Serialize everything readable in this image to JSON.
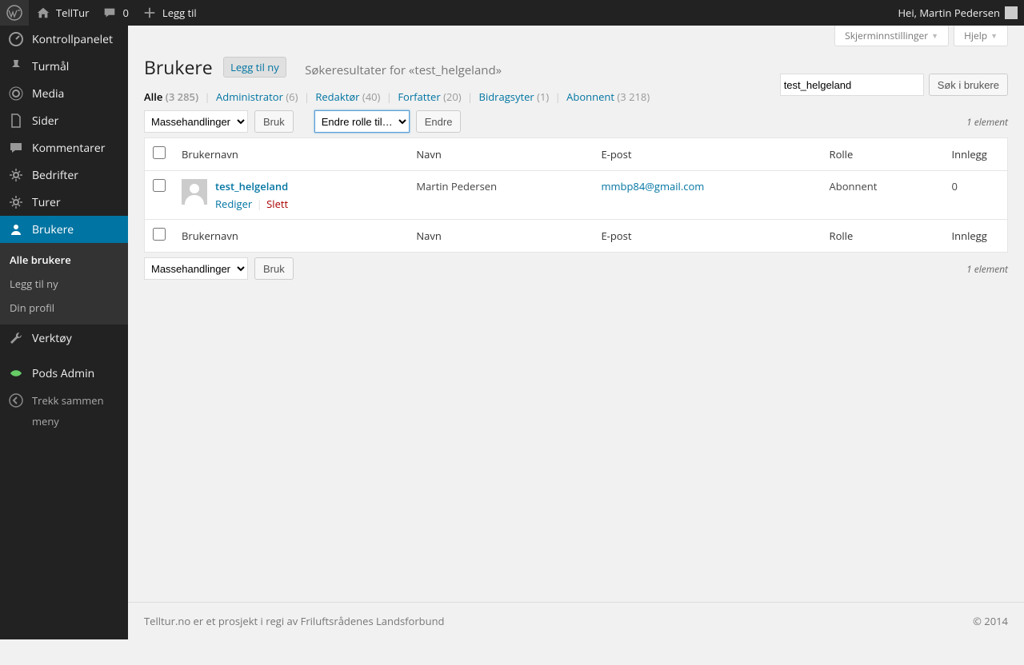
{
  "adminbar": {
    "site_name": "TellTur",
    "comments_count": "0",
    "add_new": "Legg til",
    "greeting": "Hei, Martin Pedersen"
  },
  "sidebar": {
    "items": [
      {
        "label": "Kontrollpanelet"
      },
      {
        "label": "Turmål"
      },
      {
        "label": "Media"
      },
      {
        "label": "Sider"
      },
      {
        "label": "Kommentarer"
      },
      {
        "label": "Bedrifter"
      },
      {
        "label": "Turer"
      },
      {
        "label": "Brukere"
      },
      {
        "label": "Verktøy"
      },
      {
        "label": "Pods Admin"
      }
    ],
    "submenu": [
      {
        "label": "Alle brukere"
      },
      {
        "label": "Legg til ny"
      },
      {
        "label": "Din profil"
      }
    ],
    "collapse1": "Trekk sammen",
    "collapse2": "meny"
  },
  "screen_meta": {
    "screen_options": "Skjerminnstillinger",
    "help": "Hjelp"
  },
  "header": {
    "title": "Brukere",
    "add_new": "Legg til ny",
    "search_results": "Søkeresultater for «test_helgeland»"
  },
  "filters": {
    "all_label": "Alle",
    "all_count": "(3 285)",
    "admin_label": "Administrator",
    "admin_count": "(6)",
    "editor_label": "Redaktør",
    "editor_count": "(40)",
    "author_label": "Forfatter",
    "author_count": "(20)",
    "contrib_label": "Bidragsyter",
    "contrib_count": "(1)",
    "subscriber_label": "Abonnent",
    "subscriber_count": "(3 218)"
  },
  "search": {
    "value": "test_helgeland",
    "button": "Søk i brukere"
  },
  "bulk": {
    "bulk_actions": "Massehandlinger",
    "apply": "Bruk",
    "change_role": "Endre rolle til…",
    "change": "Endre",
    "count_text": "1 element"
  },
  "table": {
    "col_username": "Brukernavn",
    "col_name": "Navn",
    "col_email": "E-post",
    "col_role": "Rolle",
    "col_posts": "Innlegg",
    "row": {
      "username": "test_helgeland",
      "name": "Martin Pedersen",
      "email": "mmbp84@gmail.com",
      "role": "Abonnent",
      "posts": "0",
      "edit": "Rediger",
      "delete": "Slett"
    }
  },
  "footer": {
    "left": "Telltur.no er et prosjekt i regi av Friluftsrådenes Landsforbund",
    "right": "© 2014"
  }
}
